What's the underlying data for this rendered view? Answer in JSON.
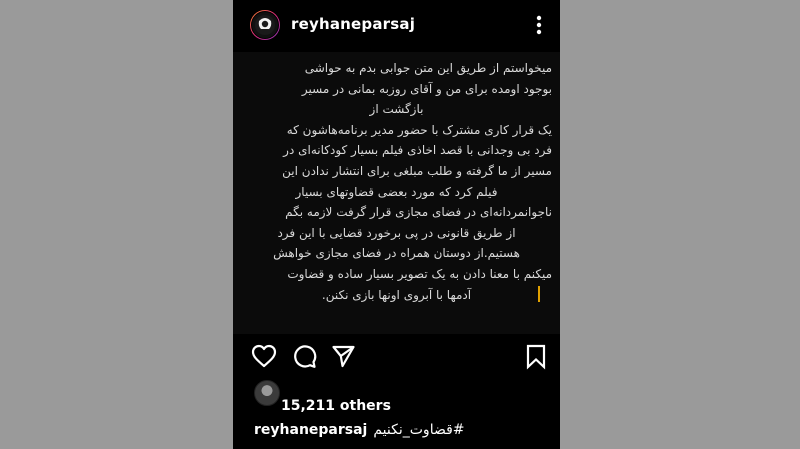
{
  "header": {
    "username": "reyhaneparsaj",
    "avatar_icon": "profile-avatar",
    "more_icon": "more-vertical-icon"
  },
  "post": {
    "lines": [
      "میخواستم از طریق این متن جوابی بدم به حواشی",
      "بوجود اومده برای  من و آقای روزبه بمانی در مسیر",
      "بازگشت از",
      "یک قرار کاری مشترک با حضور مدیر برنامه‌هاشون که",
      "فرد بی وجدانی با قصد اخاذی فیلم بسیار کودکانه‌ای در",
      "مسیر از ما گرفته و طلب مبلغی برای انتشار ندادن این",
      "فیلم کرد که مورد بعضی قضاوتهای بسیار",
      "ناجوانمردانه‌ای در فضای مجازی قرار گرفت لازمه بگم",
      "از طریق قانونی در پی برخورد قضایی با این فرد",
      "هستیم.از دوستان همراه در فضای مجازی خواهش",
      "میکنم با معنا دادن به یک تصویر بسیار ساده و قضاوت",
      "آدمها با آبروی اونها بازی نکنن."
    ]
  },
  "actions": {
    "like_icon": "heart-icon",
    "comment_icon": "comment-icon",
    "share_icon": "send-icon",
    "save_icon": "bookmark-icon"
  },
  "likes": {
    "count_text": "15,211 others"
  },
  "caption": {
    "username": "reyhaneparsaj",
    "hashtag": "قضاوت_نکنیم#"
  }
}
